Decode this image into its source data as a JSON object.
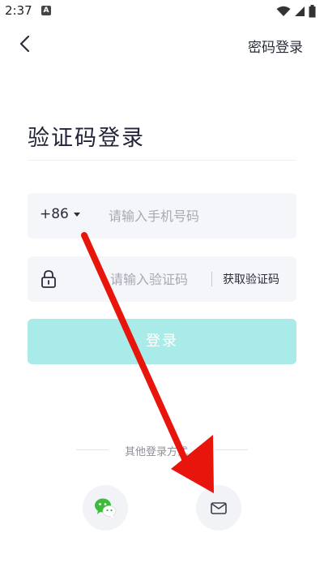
{
  "status_bar": {
    "time": "2:37",
    "notification_badge": "A",
    "icons": [
      "wifi-icon",
      "signal-icon",
      "battery-icon"
    ]
  },
  "nav": {
    "password_login_label": "密码登录"
  },
  "title": "验证码登录",
  "phone": {
    "country_code": "+86",
    "placeholder": "请输入手机号码"
  },
  "code": {
    "placeholder": "请输入验证码",
    "get_code_label": "获取验证码"
  },
  "login_button_label": "登录",
  "other_login_label": "其他登录方式",
  "social": [
    "wechat-icon",
    "mail-icon"
  ],
  "colors": {
    "accent": "#a9ebe8",
    "field_bg": "#f5f6fa",
    "annotation": "#e8150d"
  }
}
